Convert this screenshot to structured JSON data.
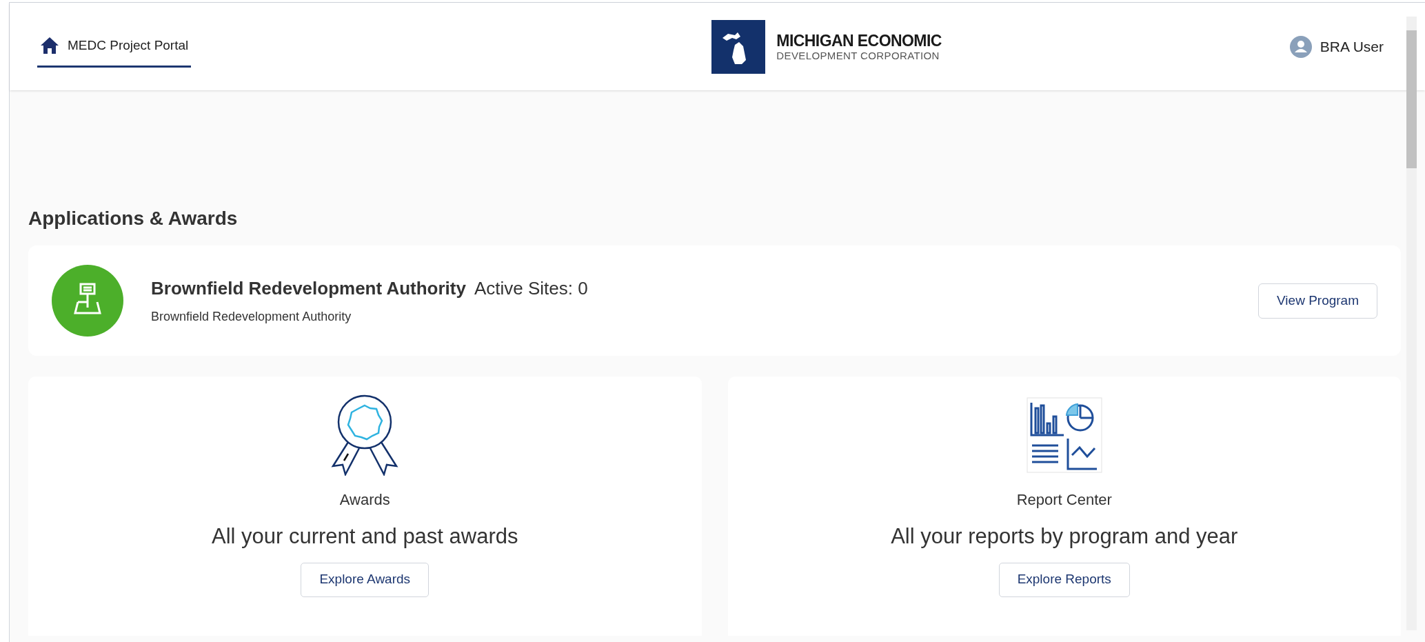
{
  "header": {
    "nav_link": {
      "label": "MEDC Project Portal",
      "selected": true
    },
    "logo": {
      "line_1": "MICHIGAN ECONOMIC",
      "line_2": "DEVELOPMENT CORPORATION"
    },
    "user": "BRA User"
  },
  "section_title": "Applications & Awards",
  "program": {
    "name": "Brownfield Redevelopment Authority",
    "active_sites": "Active Sites: 0",
    "subtitle": "Brownfield Redevelopment Authority",
    "button": "View Program"
  },
  "tiles": [
    {
      "kind": "awards",
      "title": "Awards",
      "description": "All your current and past awards",
      "button": "Explore Awards"
    },
    {
      "kind": "reports",
      "title": "Report Center",
      "description": "All your reports by program and year",
      "button": "Explore Reports"
    }
  ]
}
